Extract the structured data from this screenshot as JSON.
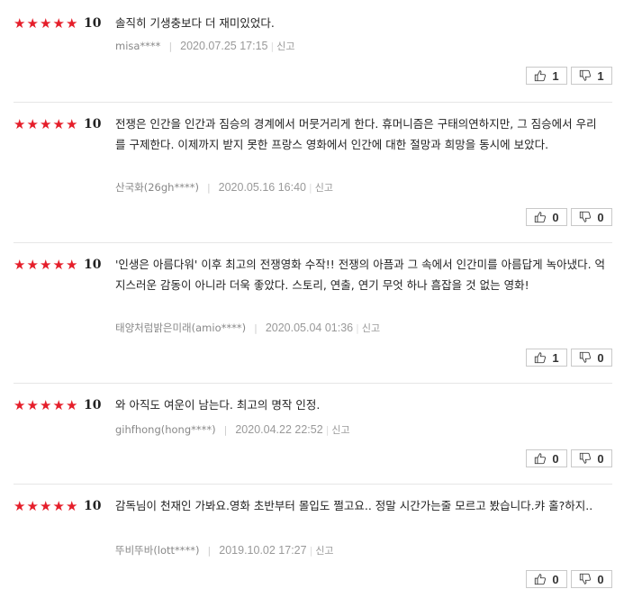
{
  "stars_icon": "five-star-rating",
  "star_color": "#e51e2a",
  "reviews": [
    {
      "score": "10",
      "text": "솔직히 기생충보다 더 재미있었다.",
      "user": "misa****",
      "date": "2020.07.25 17:15",
      "report": "신고",
      "likes": "1",
      "dislikes": "1"
    },
    {
      "score": "10",
      "text": "전쟁은 인간을 인간과 짐승의 경계에서 머뭇거리게 한다. 휴머니즘은 구태의연하지만, 그 짐승에서 우리를 구제한다. 이제까지 받지 못한 프랑스 영화에서 인간에 대한 절망과 희망을 동시에 보았다.",
      "user": "산국화(26gh****)",
      "date": "2020.05.16 16:40",
      "report": "신고",
      "likes": "0",
      "dislikes": "0"
    },
    {
      "score": "10",
      "text": "'인생은 아름다워' 이후 최고의 전쟁영화 수작!! 전쟁의 아픔과 그 속에서 인간미를 아름답게 녹아냈다. 억지스러운 감동이 아니라 더욱 좋았다. 스토리, 연출, 연기 무엇 하나 흠잡을 것 없는 영화!",
      "user": "태양처럼밝은미래(amio****)",
      "date": "2020.05.04 01:36",
      "report": "신고",
      "likes": "1",
      "dislikes": "0"
    },
    {
      "score": "10",
      "text": "와 아직도 여운이 남는다. 최고의 명작 인정.",
      "user": "gihfhong(hong****)",
      "date": "2020.04.22 22:52",
      "report": "신고",
      "likes": "0",
      "dislikes": "0"
    },
    {
      "score": "10",
      "text": "감독님이 천재인 가봐요.영화 초반부터 몰입도 쩔고요.. 정말 시간가는줄 모르고 봤습니다.캬 홀?하지..",
      "user": "뚜비뚜바(lott****)",
      "date": "2019.10.02 17:27",
      "report": "신고",
      "likes": "0",
      "dislikes": "0"
    }
  ]
}
